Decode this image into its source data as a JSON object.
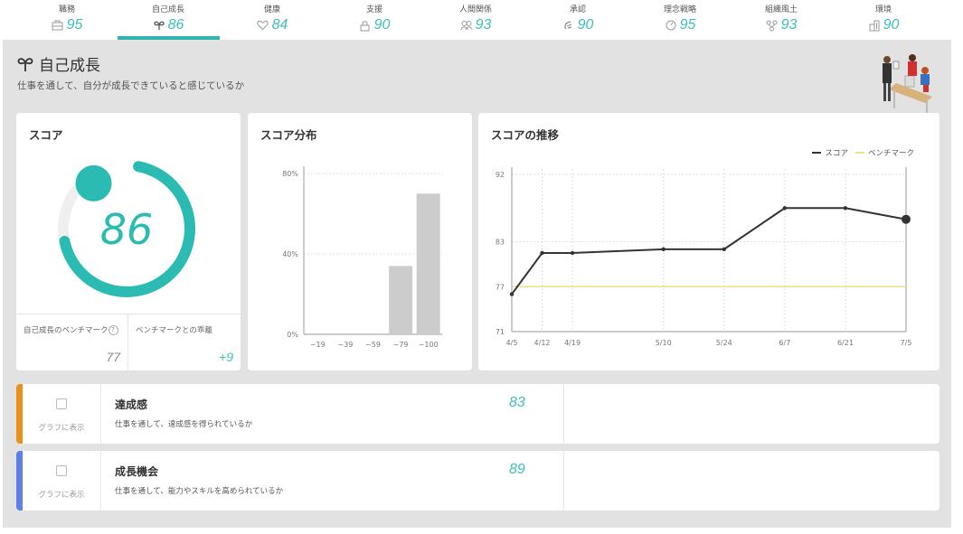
{
  "nav": {
    "active_index": 1,
    "accent": "#2fb5ae",
    "items": [
      {
        "label": "職務",
        "score": "95",
        "icon": "briefcase-icon"
      },
      {
        "label": "自己成長",
        "score": "86",
        "icon": "sprout-icon"
      },
      {
        "label": "健康",
        "score": "84",
        "icon": "heart-icon"
      },
      {
        "label": "支援",
        "score": "90",
        "icon": "lock-icon"
      },
      {
        "label": "人間関係",
        "score": "93",
        "icon": "people-icon"
      },
      {
        "label": "承認",
        "score": "90",
        "icon": "clap-icon"
      },
      {
        "label": "理念戦略",
        "score": "95",
        "icon": "compass-icon"
      },
      {
        "label": "組織風土",
        "score": "93",
        "icon": "network-icon"
      },
      {
        "label": "環境",
        "score": "90",
        "icon": "building-icon"
      }
    ]
  },
  "page": {
    "title": "自己成長",
    "subtitle": "仕事を通して、自分が成長できていると感じているか"
  },
  "score_card": {
    "title": "スコア",
    "score": "86",
    "score_fraction": 0.86,
    "benchmark_fraction": 0.77,
    "benchmark_label": "自己成長のベンチマーク",
    "help": "?",
    "benchmark_value": "77",
    "diff_label": "ベンチマークとの乖離",
    "diff_value": "+9",
    "color": "#2bbbb3",
    "track_color": "#efefef"
  },
  "chart_data": [
    {
      "type": "bar",
      "title": "スコア分布",
      "categories": [
        "~19",
        "~39",
        "~59",
        "~79",
        "~100"
      ],
      "values": [
        0,
        0,
        0,
        34,
        70
      ],
      "ylim": [
        0,
        80
      ],
      "yticks": [
        "0%",
        "40%",
        "80%"
      ],
      "ytick_values": [
        0,
        40,
        80
      ],
      "grid": true,
      "bar_color": "#cccccc",
      "xlabel": "",
      "ylabel": ""
    },
    {
      "type": "line",
      "title": "スコアの推移",
      "x": [
        "4/5",
        "4/12",
        "4/19",
        "5/10",
        "5/24",
        "6/7",
        "6/21",
        "7/5"
      ],
      "x_days": [
        0,
        7,
        14,
        35,
        49,
        63,
        77,
        91
      ],
      "series": [
        {
          "name": "スコア",
          "color": "#333333",
          "values": [
            76,
            81.5,
            81.5,
            82,
            82,
            87.5,
            87.5,
            86
          ]
        },
        {
          "name": "ベンチマーク",
          "color": "#f0e08a",
          "values": [
            77,
            77,
            77,
            77,
            77,
            77,
            77,
            77
          ]
        }
      ],
      "ylim": [
        71,
        92
      ],
      "yticks": [
        "71",
        "77",
        "83",
        "92"
      ],
      "ytick_values": [
        71,
        77,
        83,
        92
      ],
      "grid": true,
      "legend": "top-right",
      "xlabel": "",
      "ylabel": ""
    }
  ],
  "items": [
    {
      "name": "達成感",
      "desc": "仕事を通して、達成感を得られているか",
      "score": "83",
      "color": "#e8921a",
      "checkbox_label": "グラフに表示",
      "checked": false
    },
    {
      "name": "成長機会",
      "desc": "仕事を通して、能力やスキルを高められているか",
      "score": "89",
      "color": "#5b7fe6",
      "checkbox_label": "グラフに表示",
      "checked": false
    }
  ]
}
